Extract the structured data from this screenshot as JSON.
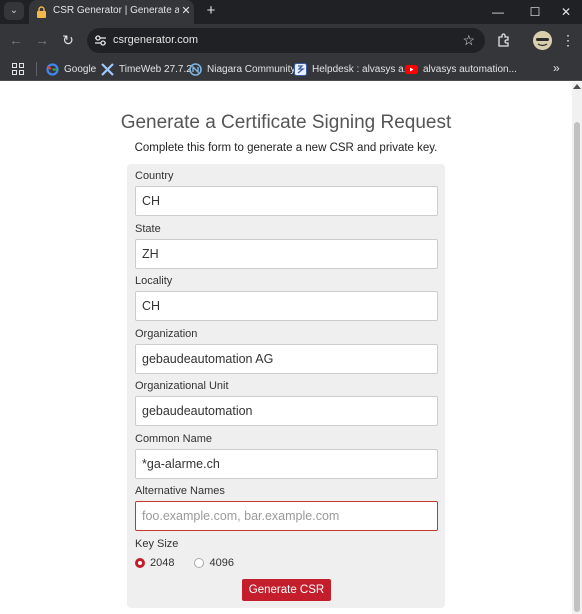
{
  "browser": {
    "tab_title": "CSR Generator | Generate a Cer",
    "url": "csrgenerator.com",
    "bookmarks": [
      {
        "label": "Google",
        "icon": "google-icon"
      },
      {
        "label": "TimeWeb 27.7.2",
        "icon": "timeweb-icon"
      },
      {
        "label": "Niagara Community",
        "icon": "niagara-icon"
      },
      {
        "label": "Helpdesk : alvasys a...",
        "icon": "helpdesk-icon"
      },
      {
        "label": "alvasys automation...",
        "icon": "youtube-icon"
      }
    ],
    "more_bookmarks": "»"
  },
  "page": {
    "title": "Generate a Certificate Signing Request",
    "subtitle": "Complete this form to generate a new CSR and private key.",
    "fields": {
      "country": {
        "label": "Country",
        "value": "CH"
      },
      "state": {
        "label": "State",
        "value": "ZH"
      },
      "locality": {
        "label": "Locality",
        "value": "CH"
      },
      "organization": {
        "label": "Organization",
        "value": "gebaudeautomation AG"
      },
      "org_unit": {
        "label": "Organizational Unit",
        "value": "gebaudeautomation"
      },
      "common_name": {
        "label": "Common Name",
        "value": "*ga-alarme.ch"
      },
      "alt_names": {
        "label": "Alternative Names",
        "value": "",
        "placeholder": "foo.example.com, bar.example.com"
      }
    },
    "key_size": {
      "label": "Key Size",
      "options": [
        "2048",
        "4096"
      ],
      "selected": "2048"
    },
    "submit_label": "Generate CSR"
  },
  "colors": {
    "accent": "#c41e2c",
    "form_bg": "#efefef"
  }
}
